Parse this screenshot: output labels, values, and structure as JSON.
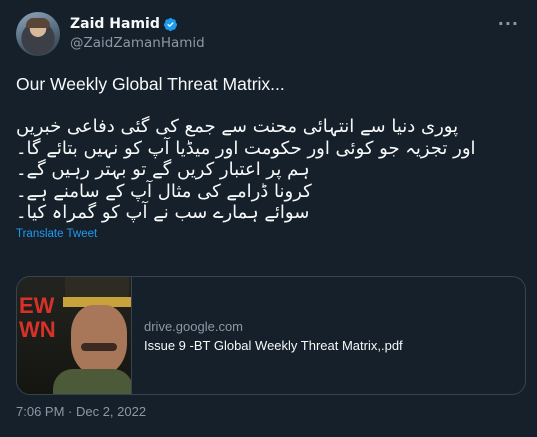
{
  "author": {
    "display_name": "Zaid Hamid",
    "handle": "@ZaidZamanHamid",
    "verified": true
  },
  "menu_icon": "more-horizontal-icon",
  "tweet": {
    "title": "Our Weekly Global Threat Matrix...",
    "body_lines": [
      "پوری دنیا سے انتہائی محنت سے جمع کی گئی دفاعی خبریں",
      "اور تجزیہ جو کوئی اور حکومت اور میڈیا آپ کو نہیں بتائے گا۔",
      "ہم پر اعتبار کریں گے تو بہتر رہیں گے۔",
      "کرونا ڈرامے کی مثال آپ کے سامنے ہے۔",
      "سوائے ہمارے سب نے آپ کو گمراہ کیا۔"
    ],
    "translate_label": "Translate Tweet"
  },
  "card": {
    "domain": "drive.google.com",
    "title": "Issue 9 -BT Global Weekly Threat Matrix,.pdf",
    "thumb_text_top": "EW",
    "thumb_text_bottom": "WN"
  },
  "timestamp": "7:06 PM · Dec 2, 2022",
  "colors": {
    "background": "#15202b",
    "text": "#f7f9f9",
    "secondary": "#8b98a5",
    "link": "#1d9bf0",
    "border": "#38444d"
  }
}
